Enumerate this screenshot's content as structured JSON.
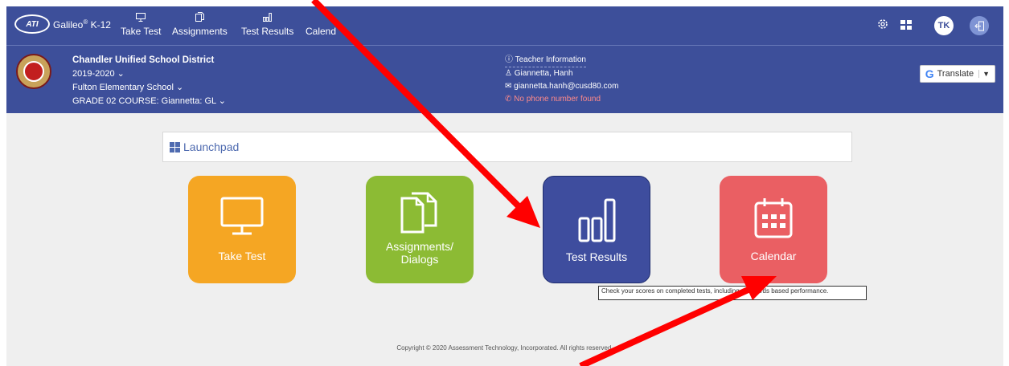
{
  "topbar": {
    "logo_text": "ATI",
    "brand": "Galileo",
    "brand_mark": "®",
    "brand_suffix": " K-12",
    "nav": [
      {
        "label": "Take Test",
        "icon": "monitor-icon"
      },
      {
        "label": "Assignments",
        "icon": "documents-icon"
      },
      {
        "label": "Test Results",
        "icon": "bar-chart-icon"
      },
      {
        "label": "Calend",
        "icon": "calendar-icon"
      }
    ],
    "avatar_initials": "TK",
    "right_icons": [
      "gear-icon",
      "grid-icon",
      "exit-icon"
    ]
  },
  "info": {
    "district": "Chandler Unified School District",
    "year": "2019-2020",
    "school": "Fulton Elementary School",
    "course": "GRADE 02 COURSE: Giannetta: GL",
    "teacher_heading": "Teacher Information",
    "teacher_name": "Giannetta, Hanh",
    "teacher_email": "giannetta.hanh@cusd80.com",
    "teacher_phone": "No phone number found",
    "translate_label": "Translate",
    "translate_caret": "▼"
  },
  "launchpad": {
    "title": "Launchpad",
    "tiles": [
      {
        "label": "Take Test",
        "color": "#f5a623"
      },
      {
        "label": "Assignments/\nDialogs",
        "color": "#8cbb34"
      },
      {
        "label": "Test Results",
        "color": "#3e4d9e"
      },
      {
        "label": "Calendar",
        "color": "#ea5f63"
      }
    ],
    "tooltip": "Check your scores on completed tests, including standards based performance."
  },
  "footer": {
    "copyright": "Copyright © 2020 Assessment Technology, Incorporated. All rights reserved."
  },
  "colors": {
    "header": "#3d4f9a",
    "annotation_arrow": "#ff0000"
  }
}
